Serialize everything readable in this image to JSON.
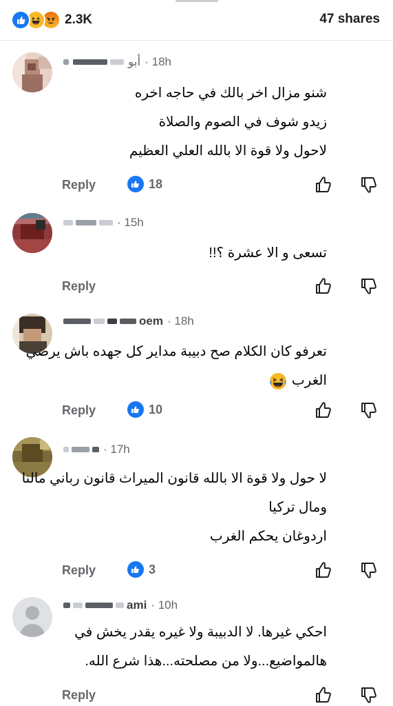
{
  "header": {
    "reaction_count": "2.3K",
    "reactions": [
      "like-icon",
      "haha-icon",
      "angry-icon"
    ],
    "shares": "47 shares"
  },
  "comments": [
    {
      "time": "18h",
      "name_visible": "أبو",
      "lines": [
        "شنو مزال اخر بالك في حاجه اخره",
        "زيدو شوف في الصوم  والصلاة",
        "لاحول ولا قوة الا بالله العلي العظيم"
      ],
      "reply": "Reply",
      "likes": "18"
    },
    {
      "time": "15h",
      "name_visible": "",
      "lines": [
        "تسعى و الا عشرة ؟!!"
      ],
      "reply": "Reply",
      "likes": ""
    },
    {
      "time": "18h",
      "name_visible": "oem",
      "lines": [
        "تعرفو كان الكلام صح دبيبة مداير كل جهده باش يرضي",
        "الغرب"
      ],
      "reply": "Reply",
      "likes": "10"
    },
    {
      "time": "17h",
      "name_visible": "",
      "lines": [
        "لا حول ولا قوة الا بالله قانون الميراث قانون رباني مالنا",
        "ومال تركيا",
        "اردوغان يحكم الغرب"
      ],
      "reply": "Reply",
      "likes": "3"
    },
    {
      "time": "10h",
      "name_visible": "ami",
      "lines": [
        "احكي غيرها. لا الدبيبة ولا غيره يقدر يخش في",
        "هالمواضيع...ولا من مصلحته...هذا شرع الله."
      ],
      "reply": "Reply",
      "likes": ""
    }
  ],
  "colors": {
    "accent": "#1877f2",
    "meta_text": "#65676b",
    "divider": "#e4e6eb"
  }
}
